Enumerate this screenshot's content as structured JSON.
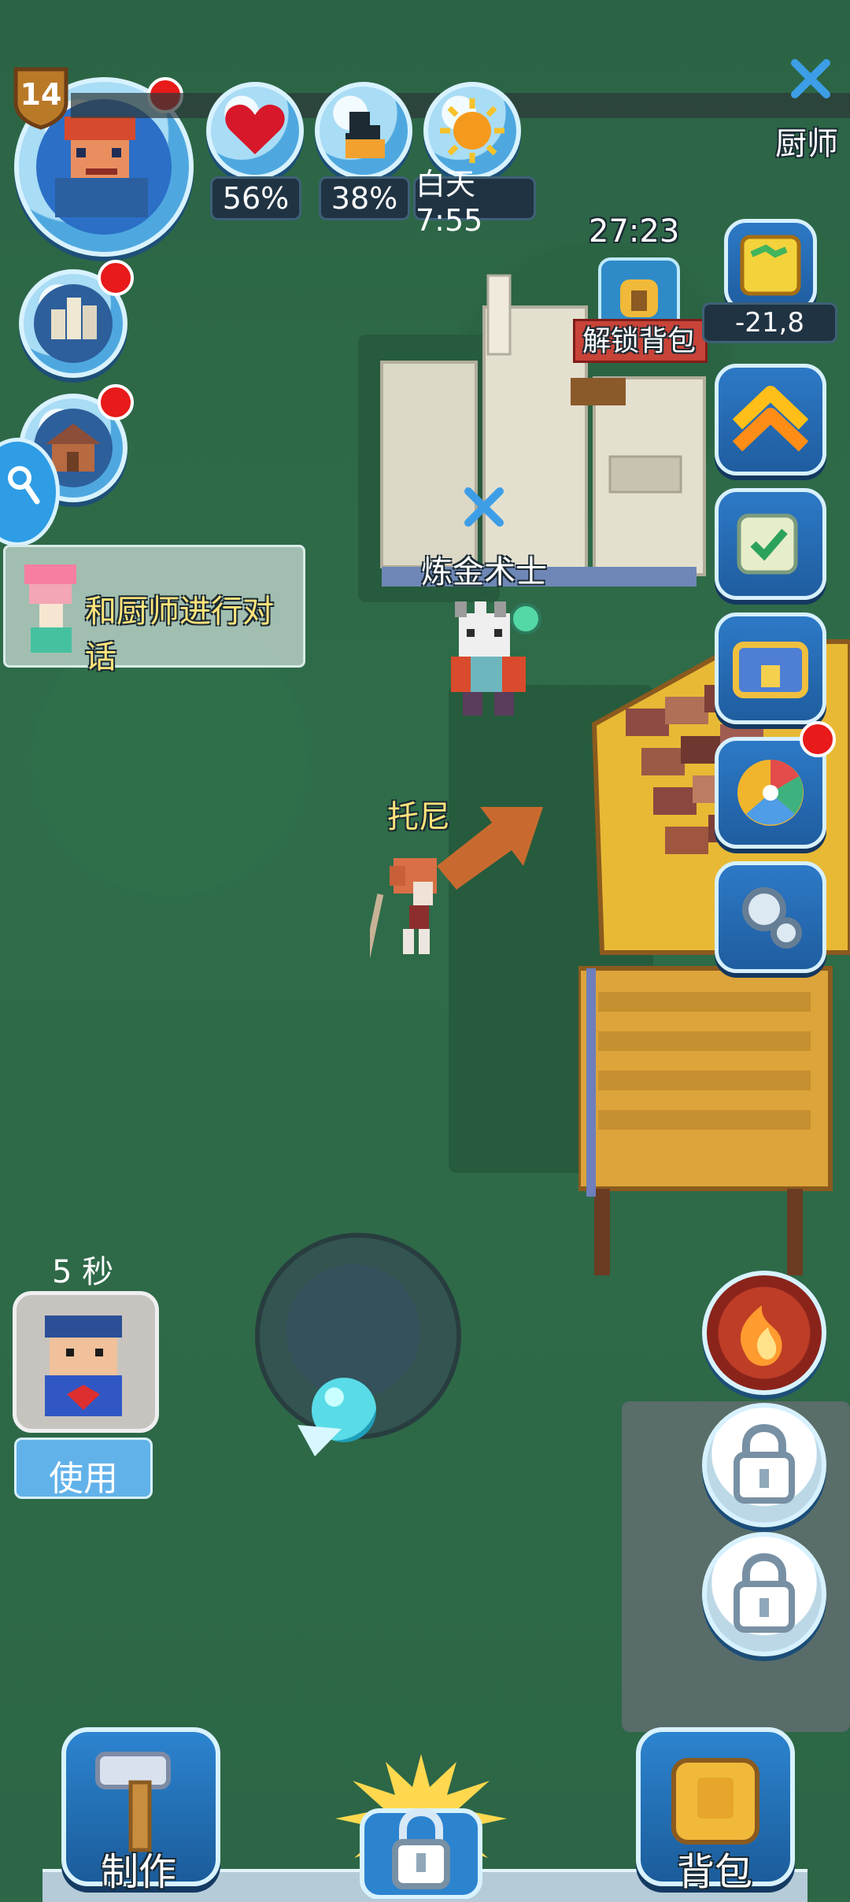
{
  "player": {
    "level": "14",
    "name": "托尼"
  },
  "stats": {
    "health_percent": "56%",
    "hunger_percent": "38%",
    "time_label": "白天7:55"
  },
  "quest": {
    "text": "和厨师进行对话"
  },
  "timer": {
    "value": "27:23",
    "unlock_label": "解锁背包"
  },
  "map": {
    "coords": "-21,8"
  },
  "npc": {
    "chef_label": "厨师",
    "alchemist_label": "炼金术士"
  },
  "skill": {
    "cooldown": "5 秒",
    "use_label": "使用"
  },
  "bottom": {
    "craft_label": "制作",
    "bag_label": "背包"
  },
  "icons": {
    "health": "heart-icon",
    "hunger": "food-icon",
    "time": "sun-icon",
    "search": "magnifier-icon",
    "settings": "gear-icon",
    "fire": "fire-icon",
    "lock": "lock-icon"
  }
}
